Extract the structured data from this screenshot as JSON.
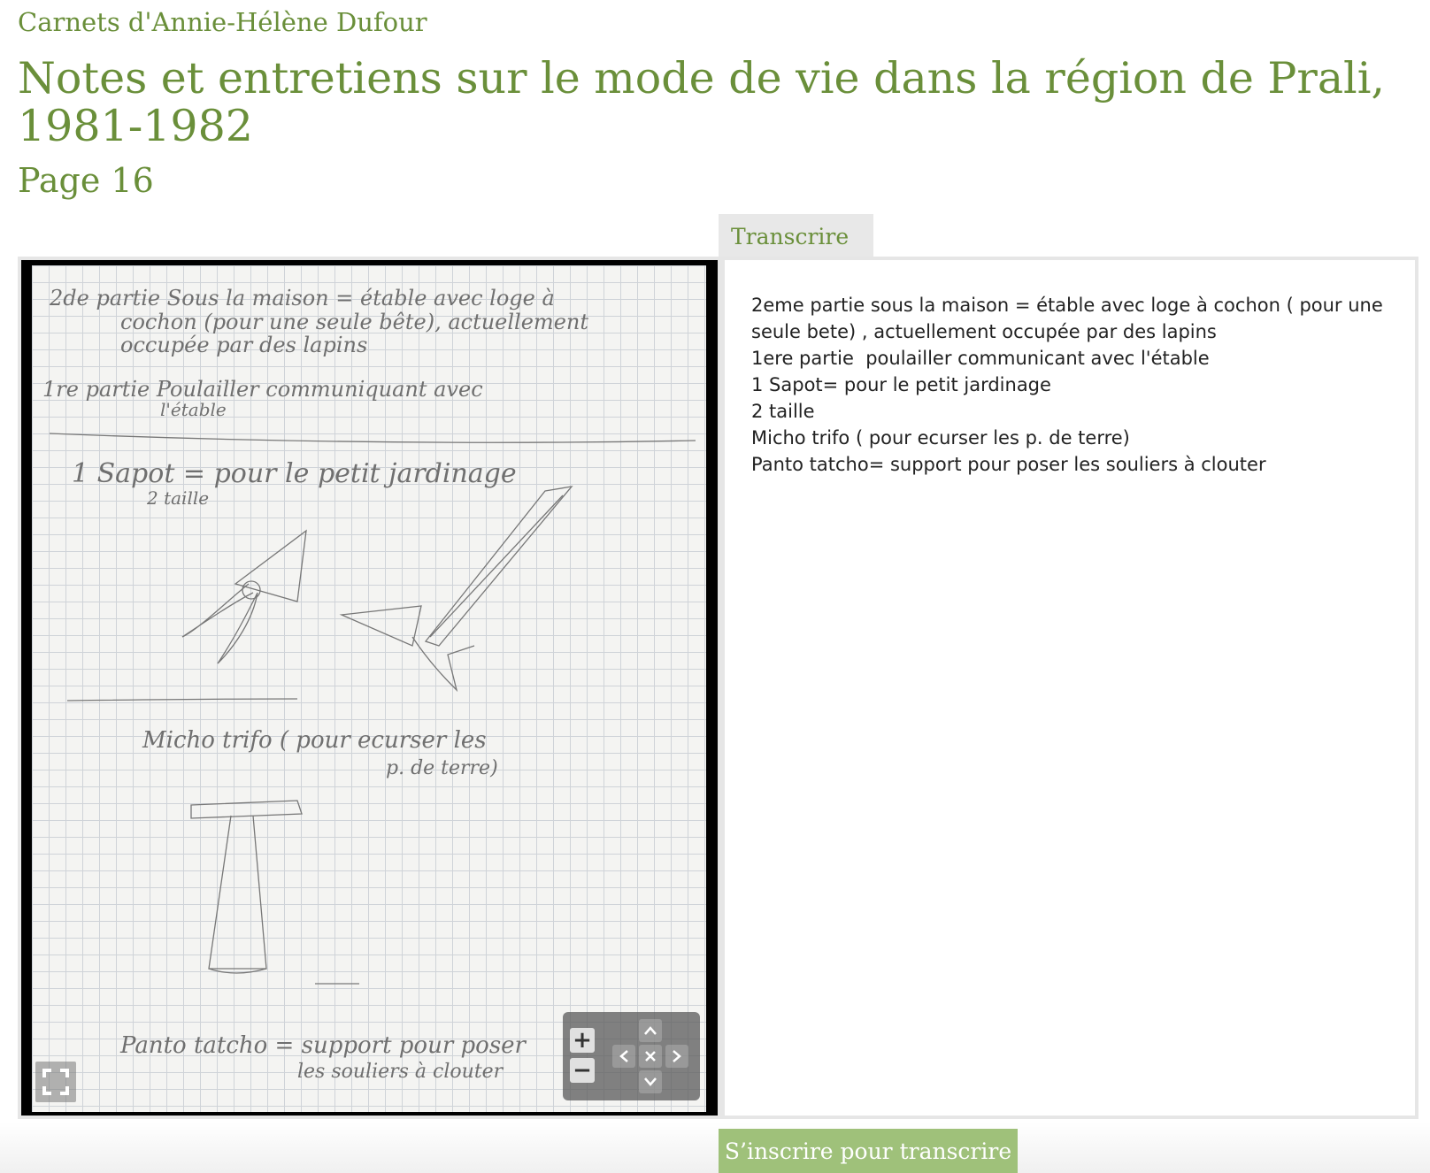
{
  "header": {
    "collection": "Carnets d'Annie-Hélène Dufour",
    "title": "Notes et entretiens sur le mode de vie dans la région de Prali, 1981-1982",
    "page": "Page 16"
  },
  "tabs": {
    "transcribe": "Transcrire"
  },
  "viewer": {
    "image_handwriting": [
      "2de partie Sous la maison = étable avec loge à cochon (pour une seule bête), actuellement occupée par des lapins",
      "1re partie Poulailler communiquant avec l'étable",
      "1 Sapot = pour le petit jardinage",
      "2 taille",
      "Micho trifo ( pour ecurser les p. de terre)",
      "Panto tatcho = support pour poser les souliers à clouter"
    ],
    "controls": {
      "zoom_in": "+",
      "zoom_out": "−",
      "pan_up": "⌃",
      "pan_down": "⌄",
      "pan_left": "‹",
      "pan_right": "›",
      "reset": "✕",
      "fullscreen_icon": "fullscreen-icon"
    }
  },
  "transcription": {
    "lines": [
      "2eme partie sous la maison = étable avec loge à cochon ( pour une seule bete) , actuellement occupée par des lapins",
      "1ere partie  poulailler communicant avec l'étable",
      "1 Sapot= pour le petit jardinage",
      "2 taille",
      "Micho trifo ( pour ecurser les p. de terre)",
      "Panto tatcho= support pour poser les souliers à clouter"
    ]
  },
  "footer": {
    "signup_label": "S’inscrire pour transcrire"
  },
  "colors": {
    "accent": "#6a8f3a",
    "button": "#9fc17a",
    "panel": "#e6e6e6"
  }
}
